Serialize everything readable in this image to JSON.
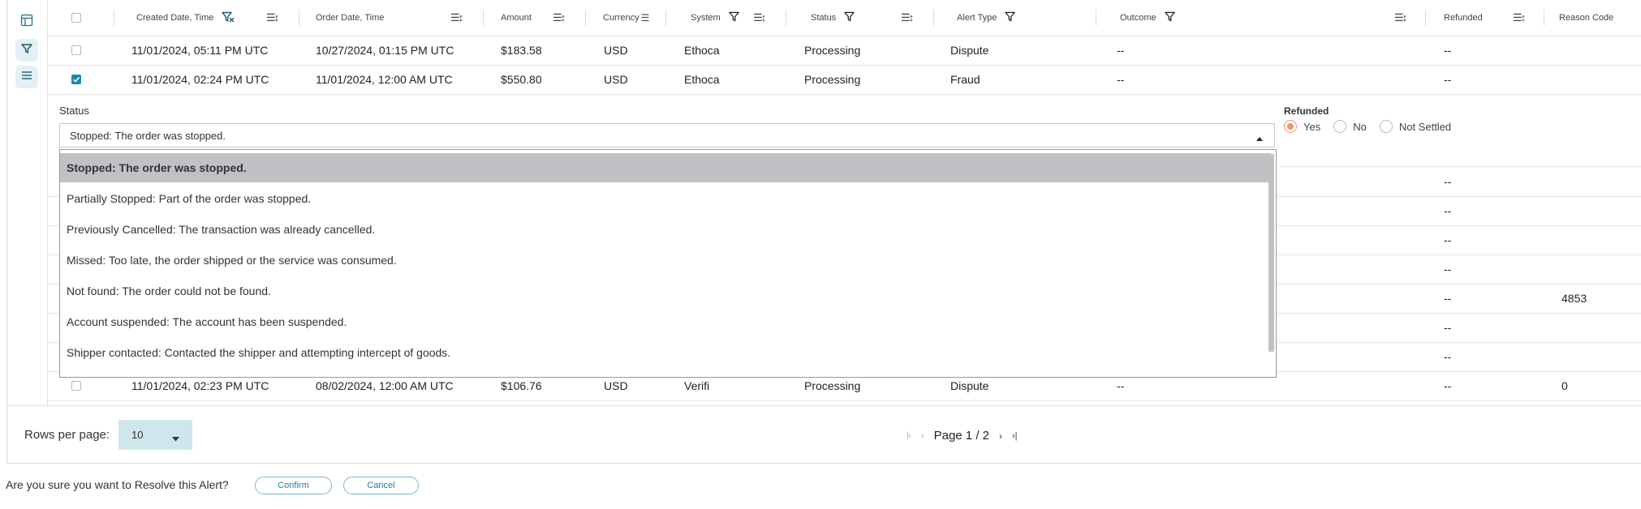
{
  "table": {
    "columns": [
      {
        "label": "Created Date, Time"
      },
      {
        "label": "Order Date, Time"
      },
      {
        "label": "Amount"
      },
      {
        "label": "Currency"
      },
      {
        "label": "System"
      },
      {
        "label": "Status"
      },
      {
        "label": "Alert Type"
      },
      {
        "label": "Outcome"
      },
      {
        "label": "Refunded"
      },
      {
        "label": "Reason Code"
      }
    ],
    "rows": [
      {
        "created": "11/01/2024, 05:11 PM UTC",
        "order": "10/27/2024, 01:15 PM UTC",
        "amount": "$183.58",
        "currency": "USD",
        "system": "Ethoca",
        "status": "Processing",
        "alert_type": "Dispute",
        "outcome": "--",
        "refunded": "--",
        "reason_code": ""
      },
      {
        "created": "11/01/2024, 02:24 PM UTC",
        "order": "11/01/2024, 12:00 AM UTC",
        "amount": "$550.80",
        "currency": "USD",
        "system": "Ethoca",
        "status": "Processing",
        "alert_type": "Fraud",
        "outcome": "--",
        "refunded": "--",
        "reason_code": ""
      }
    ],
    "partial_rows": [
      {
        "refunded": "--",
        "reason_code": ""
      },
      {
        "refunded": "--",
        "reason_code": ""
      },
      {
        "refunded": "--",
        "reason_code": ""
      },
      {
        "refunded": "--",
        "reason_code": ""
      },
      {
        "refunded": "--",
        "reason_code": "4853"
      },
      {
        "refunded": "--",
        "reason_code": ""
      },
      {
        "refunded": "--",
        "reason_code": ""
      }
    ],
    "last_row": {
      "created": "11/01/2024, 02:23 PM UTC",
      "order": "08/02/2024, 12:00 AM UTC",
      "amount": "$106.76",
      "currency": "USD",
      "system": "Verifi",
      "status": "Processing",
      "alert_type": "Dispute",
      "outcome": "--",
      "refunded": "--",
      "reason_code": "0"
    }
  },
  "expanded": {
    "status_label": "Status",
    "status_value": "Stopped: The order was stopped.",
    "options": [
      "Stopped: The order was stopped.",
      "Partially Stopped: Part of the order was stopped.",
      "Previously Cancelled: The transaction was already cancelled.",
      "Missed: Too late, the order shipped or the service was consumed.",
      "Not found: The order could not be found.",
      "Account suspended: The account has been suspended.",
      "Shipper contacted: Contacted the shipper and attempting intercept of goods."
    ],
    "refunded_label": "Refunded",
    "refunded_options": [
      "Yes",
      "No",
      "Not Settled"
    ],
    "refunded_selected": "Yes"
  },
  "footer": {
    "rows_per_page_label": "Rows per page:",
    "rows_per_page_value": "10",
    "page_label": "Page 1 / 2"
  },
  "confirm_bar": {
    "question": "Are you sure you want to Resolve this Alert?",
    "confirm_label": "Confirm",
    "cancel_label": "Cancel"
  },
  "colors": {
    "accent": "#1a8bad",
    "radio_on": "#f0976a",
    "selected_option_bg": "#bfc1c5"
  }
}
